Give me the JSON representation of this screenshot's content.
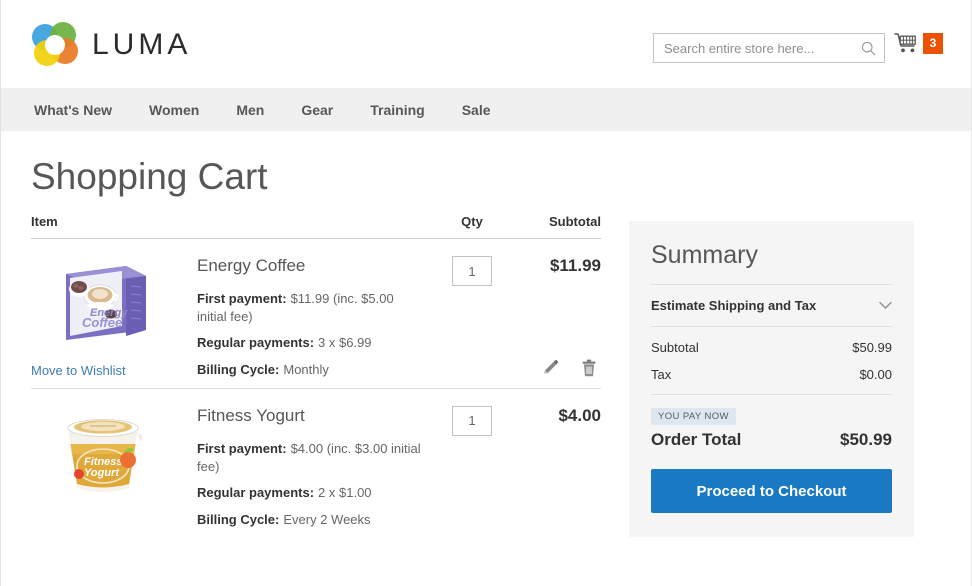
{
  "header": {
    "logo_text": "LUMA",
    "search": {
      "placeholder": "Search entire store here...",
      "value": ""
    },
    "cart_count": "3"
  },
  "nav": {
    "items": [
      {
        "label": "What's New"
      },
      {
        "label": "Women"
      },
      {
        "label": "Men"
      },
      {
        "label": "Gear"
      },
      {
        "label": "Training"
      },
      {
        "label": "Sale"
      }
    ]
  },
  "main": {
    "page_title": "Shopping Cart",
    "table_headers": {
      "item": "Item",
      "qty": "Qty",
      "subtotal": "Subtotal"
    },
    "wishlist_link": "Move to Wishlist",
    "rows": [
      {
        "name": "Energy Coffee",
        "qty": "1",
        "subtotal": "$11.99",
        "options": [
          {
            "label": "First payment:",
            "value": "$11.99 (inc. $5.00 initial fee)"
          },
          {
            "label": "Regular payments:",
            "value": "3 x $6.99"
          },
          {
            "label": "Billing Cycle:",
            "value": "Monthly"
          }
        ]
      },
      {
        "name": "Fitness Yogurt",
        "qty": "1",
        "subtotal": "$4.00",
        "options": [
          {
            "label": "First payment:",
            "value": "$4.00 (inc. $3.00 initial fee)"
          },
          {
            "label": "Regular payments:",
            "value": "2 x $1.00"
          },
          {
            "label": "Billing Cycle:",
            "value": "Every 2 Weeks"
          }
        ]
      }
    ]
  },
  "summary": {
    "title": "Summary",
    "estimate_label": "Estimate Shipping and Tax",
    "subtotal_label": "Subtotal",
    "subtotal_value": "$50.99",
    "tax_label": "Tax",
    "tax_value": "$0.00",
    "pay_now_badge": "YOU PAY NOW",
    "order_total_label": "Order Total",
    "order_total_value": "$50.99",
    "checkout_label": "Proceed to Checkout"
  },
  "colors": {
    "accent_blue": "#1979c3",
    "cart_badge_orange": "#eb5202",
    "link_blue": "#3f7cb0",
    "nav_bg": "#f0f0f0",
    "summary_bg": "#f5f5f5",
    "badge_bg": "#dde7ef"
  }
}
